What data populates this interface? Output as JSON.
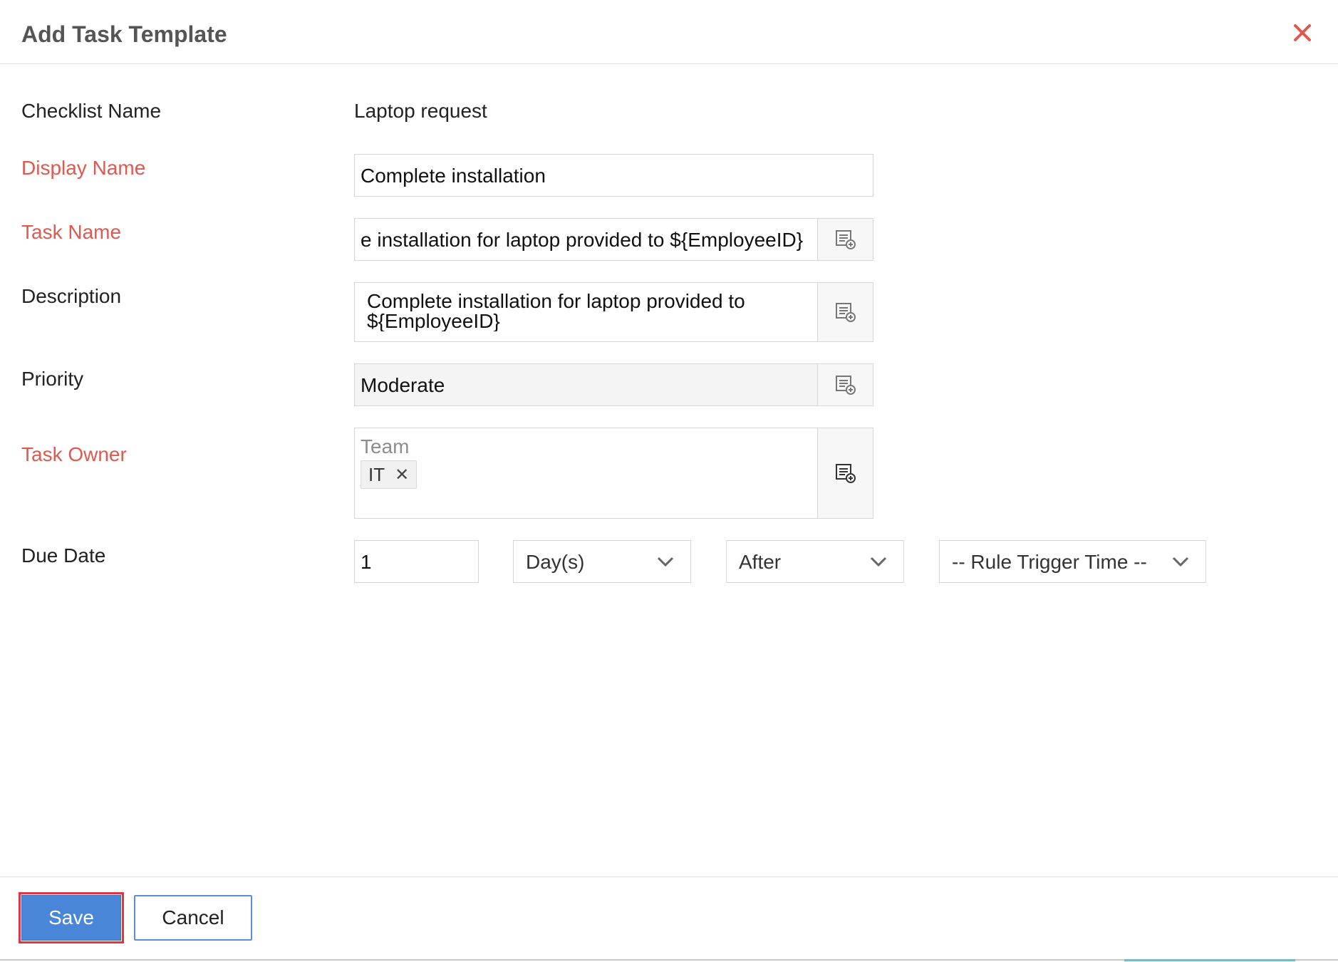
{
  "dialog": {
    "title": "Add Task Template"
  },
  "form": {
    "checklist_name": {
      "label": "Checklist Name",
      "value": "Laptop request"
    },
    "display_name": {
      "label": "Display Name",
      "value": "Complete installation"
    },
    "task_name": {
      "label": "Task Name",
      "value": "e installation for laptop provided to ${EmployeeID}"
    },
    "description": {
      "label": "Description",
      "line1": "Complete installation for laptop provided to",
      "line2": "${EmployeeID}"
    },
    "priority": {
      "label": "Priority",
      "value": "Moderate"
    },
    "task_owner": {
      "label": "Task Owner",
      "placeholder": "Team",
      "chips": [
        "IT"
      ]
    },
    "due_date": {
      "label": "Due Date",
      "count": "1",
      "unit": "Day(s)",
      "relation": "After",
      "reference": "-- Rule Trigger Time --"
    }
  },
  "footer": {
    "save_label": "Save",
    "cancel_label": "Cancel"
  },
  "colors": {
    "required_label": "#e0594f",
    "primary_button": "#4a86d8",
    "highlight_outline": "#e5343d"
  },
  "icons": {
    "close": "close-icon",
    "variable_insert": "insert-variable-icon",
    "dropdown": "chevron-down-icon"
  }
}
